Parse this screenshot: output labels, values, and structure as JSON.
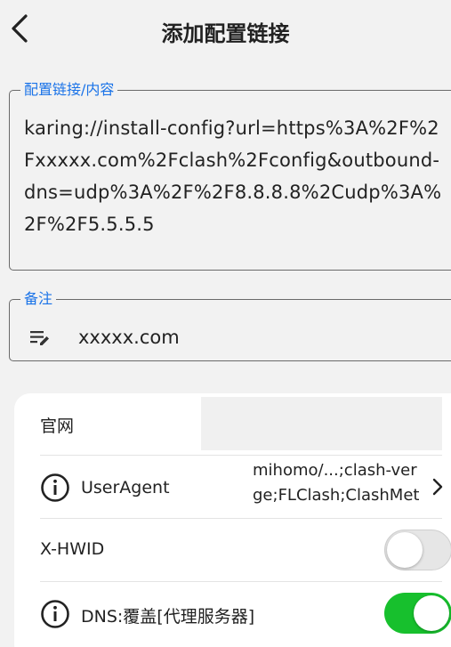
{
  "header": {
    "title": "添加配置链接",
    "back_icon": "chevron-left-icon"
  },
  "config_link": {
    "label": "配置链接/内容",
    "value": "karing://install-config?url=https%3A%2F%2Fxxxxx.com%2Fclash%2Fconfig&outbound-dns=udp%3A%2F%2F8.8.8.8%2Cudp%3A%2F%2F5.5.5.5"
  },
  "remark": {
    "label": "备注",
    "icon": "edit-note-icon",
    "value": "xxxxx.com"
  },
  "settings": {
    "website_label": "官网",
    "website_value": "",
    "useragent_label": "UserAgent",
    "useragent_value": "mihomo/...;clash-verge;FLClash;ClashMeta",
    "hwid_label": "X-HWID",
    "hwid_enabled": false,
    "dns_label": "DNS:覆盖[代理服务器]",
    "dns_enabled": true
  },
  "colors": {
    "accent": "#1a73e8",
    "toggle_on": "#17c02d",
    "toggle_off": "#e6e6e6"
  }
}
